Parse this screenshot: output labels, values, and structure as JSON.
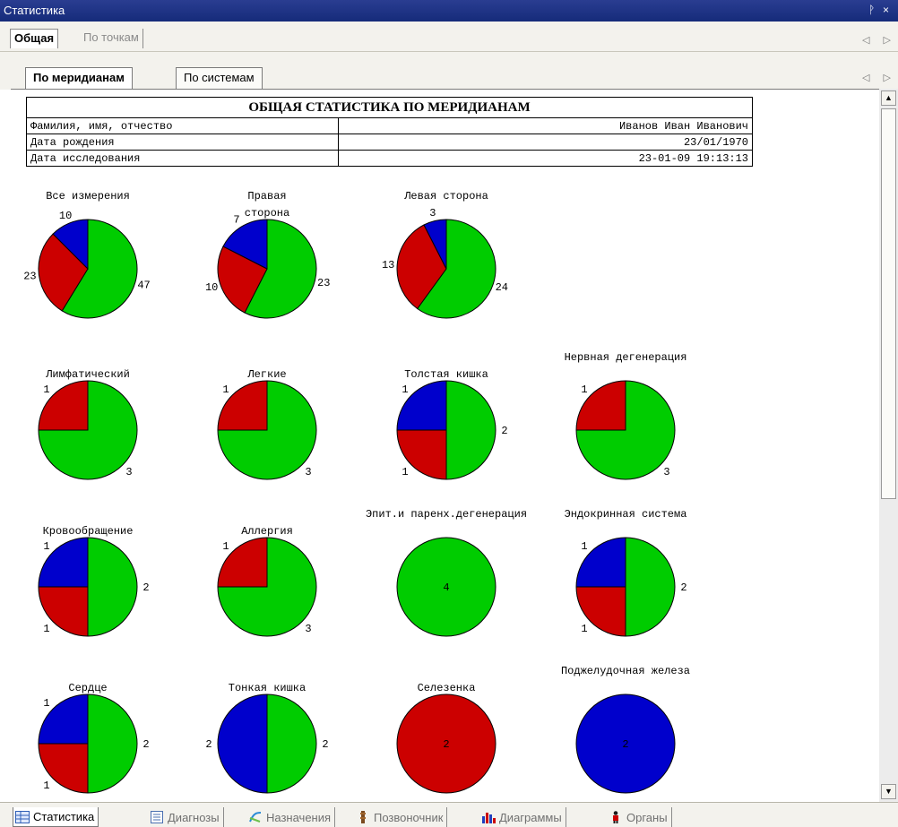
{
  "window": {
    "title": "Статистика",
    "pin_glyph": "ᚹ",
    "close_glyph": "×"
  },
  "top_tabs": [
    {
      "label": "Общая",
      "active": true
    },
    {
      "label": "По точкам",
      "active": false
    }
  ],
  "sub_tabs": [
    {
      "label": "По меридианам",
      "active": true
    },
    {
      "label": "По системам",
      "active": false
    }
  ],
  "nav_arrows": "◁ ▷",
  "report": {
    "title": "ОБЩАЯ СТАТИСТИКА ПО МЕРИДИАНАМ",
    "rows": [
      {
        "label": "Фамилия, имя, отчество",
        "value": "Иванов Иван Иванович"
      },
      {
        "label": "Дата рождения",
        "value": "23/01/1970"
      },
      {
        "label": "Дата исследования",
        "value": "23-01-09 19:13:13"
      }
    ]
  },
  "colors": {
    "green": "#00cc00",
    "red": "#cc0000",
    "blue": "#0000cc"
  },
  "chart_data": [
    {
      "type": "pie",
      "title": "Все измерения",
      "slices": [
        {
          "color": "green",
          "value": 47
        },
        {
          "color": "red",
          "value": 23
        },
        {
          "color": "blue",
          "value": 10
        }
      ]
    },
    {
      "type": "pie",
      "title": "Правая сторона",
      "slices": [
        {
          "color": "green",
          "value": 23
        },
        {
          "color": "red",
          "value": 10
        },
        {
          "color": "blue",
          "value": 7
        }
      ]
    },
    {
      "type": "pie",
      "title": "Левая сторона",
      "slices": [
        {
          "color": "green",
          "value": 24
        },
        {
          "color": "red",
          "value": 13
        },
        {
          "color": "blue",
          "value": 3
        }
      ]
    },
    {
      "type": "pie",
      "title": "Лимфатический",
      "slices": [
        {
          "color": "green",
          "value": 3
        },
        {
          "color": "red",
          "value": 1
        }
      ]
    },
    {
      "type": "pie",
      "title": "Легкие",
      "slices": [
        {
          "color": "green",
          "value": 3
        },
        {
          "color": "red",
          "value": 1
        }
      ]
    },
    {
      "type": "pie",
      "title": "Толстая кишка",
      "slices": [
        {
          "color": "green",
          "value": 2
        },
        {
          "color": "red",
          "value": 1
        },
        {
          "color": "blue",
          "value": 1
        }
      ]
    },
    {
      "type": "pie",
      "title": "Нервная дегенерация",
      "slices": [
        {
          "color": "green",
          "value": 3
        },
        {
          "color": "red",
          "value": 1
        }
      ]
    },
    {
      "type": "pie",
      "title": "Кровообращение",
      "slices": [
        {
          "color": "green",
          "value": 2
        },
        {
          "color": "red",
          "value": 1
        },
        {
          "color": "blue",
          "value": 1
        }
      ]
    },
    {
      "type": "pie",
      "title": "Аллергия",
      "slices": [
        {
          "color": "green",
          "value": 3
        },
        {
          "color": "red",
          "value": 1
        }
      ]
    },
    {
      "type": "pie",
      "title": "Эпит.и паренх.дегенерация",
      "slices": [
        {
          "color": "green",
          "value": 4
        }
      ]
    },
    {
      "type": "pie",
      "title": "Эндокринная система",
      "slices": [
        {
          "color": "green",
          "value": 2
        },
        {
          "color": "red",
          "value": 1
        },
        {
          "color": "blue",
          "value": 1
        }
      ]
    },
    {
      "type": "pie",
      "title": "Сердце",
      "slices": [
        {
          "color": "green",
          "value": 2
        },
        {
          "color": "red",
          "value": 1
        },
        {
          "color": "blue",
          "value": 1
        }
      ]
    },
    {
      "type": "pie",
      "title": "Тонкая кишка",
      "slices": [
        {
          "color": "green",
          "value": 2
        },
        {
          "color": "blue",
          "value": 2
        }
      ]
    },
    {
      "type": "pie",
      "title": "Селезенка",
      "slices": [
        {
          "color": "red",
          "value": 2
        }
      ]
    },
    {
      "type": "pie",
      "title": "Поджелудочная железа",
      "slices": [
        {
          "color": "blue",
          "value": 2
        }
      ]
    }
  ],
  "bottom_tabs": [
    {
      "label": "Статистика",
      "icon": "table-icon",
      "active": true
    },
    {
      "label": "Диагнозы",
      "icon": "list-icon",
      "active": false
    },
    {
      "label": "Назначения",
      "icon": "prescription-icon",
      "active": false
    },
    {
      "label": "Позвоночник",
      "icon": "spine-icon",
      "active": false
    },
    {
      "label": "Диаграммы",
      "icon": "chart-icon",
      "active": false
    },
    {
      "label": "Органы",
      "icon": "body-icon",
      "active": false
    }
  ]
}
